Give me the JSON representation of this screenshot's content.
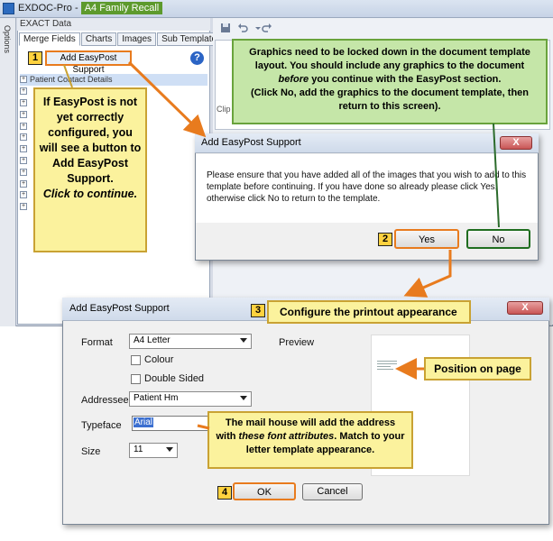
{
  "app": {
    "title_prefix": "EXDOC-Pro - ",
    "title_highlight": "A4 Family Recall",
    "options_label": "Options",
    "exact_header": "EXACT Data",
    "tabs": [
      {
        "label": "Merge Fields",
        "active": true
      },
      {
        "label": "Charts",
        "active": false
      },
      {
        "label": "Images",
        "active": false
      },
      {
        "label": "Sub Templates",
        "active": false
      }
    ],
    "add_easypost_button": "Add EasyPost Support",
    "help_glyph": "?",
    "tree_first_item": "Patient Contact Details",
    "clip_label": "Clip"
  },
  "steps": [
    "1",
    "2",
    "3",
    "4"
  ],
  "callouts": {
    "left": {
      "line1": "If EasyPost is not yet correctly configured, you will see a button to Add EasyPost Support.",
      "line2": "Click to continue."
    },
    "green": {
      "part1": "Graphics need to be locked down in the document template layout. You should include any graphics to the document ",
      "italic": "before",
      "part2": " you continue with the EasyPost section.",
      "part3": "(Click No, add the graphics to the document template, then return to this screen)."
    },
    "configure": "Configure the printout appearance",
    "position": "Position on page",
    "font": {
      "part1": "The mail house will add the address with ",
      "italic": "these font attributes",
      "part2": ". Match to your letter template appearance."
    }
  },
  "dialog1": {
    "title": "Add EasyPost Support",
    "close": "X",
    "message": "Please ensure that you have added all of the images that you wish to add to this template before continuing. If you have done so already please click Yes, otherwise click No to return to the template.",
    "yes": "Yes",
    "no": "No"
  },
  "dialog2": {
    "title": "Add EasyPost Support",
    "close": "X",
    "format_label": "Format",
    "format_value": "A4 Letter",
    "colour_label": "Colour",
    "colour_checked": false,
    "double_sided_label": "Double Sided",
    "double_sided_checked": false,
    "addressee_label": "Addressee",
    "addressee_value": "Patient Hm",
    "typeface_label": "Typeface",
    "typeface_value": "Arial",
    "size_label": "Size",
    "size_value": "11",
    "preview_label": "Preview",
    "ok": "OK",
    "cancel": "Cancel"
  },
  "colors": {
    "accent_orange": "#e87b1e",
    "callout_yellow": "#fbf29d",
    "callout_green": "#c5e6a8",
    "title_highlight": "#5d9a2d"
  }
}
